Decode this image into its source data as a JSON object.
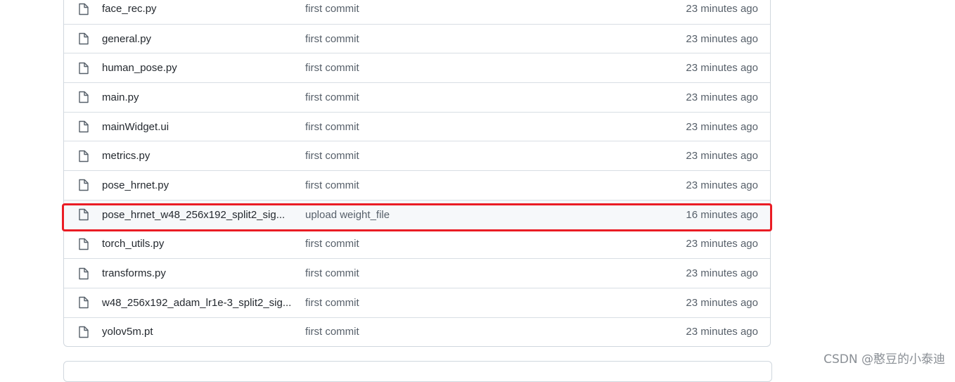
{
  "file_list": {
    "rows": [
      {
        "icon": "file-icon",
        "name": "face_rec.py",
        "message": "first commit",
        "age": "23 minutes ago"
      },
      {
        "icon": "file-icon",
        "name": "general.py",
        "message": "first commit",
        "age": "23 minutes ago"
      },
      {
        "icon": "file-icon",
        "name": "human_pose.py",
        "message": "first commit",
        "age": "23 minutes ago"
      },
      {
        "icon": "file-icon",
        "name": "main.py",
        "message": "first commit",
        "age": "23 minutes ago"
      },
      {
        "icon": "file-icon",
        "name": "mainWidget.ui",
        "message": "first commit",
        "age": "23 minutes ago"
      },
      {
        "icon": "file-icon",
        "name": "metrics.py",
        "message": "first commit",
        "age": "23 minutes ago"
      },
      {
        "icon": "file-icon",
        "name": "pose_hrnet.py",
        "message": "first commit",
        "age": "23 minutes ago"
      },
      {
        "icon": "file-icon",
        "name": "pose_hrnet_w48_256x192_split2_sig...",
        "message": "upload weight_file",
        "age": "16 minutes ago"
      },
      {
        "icon": "file-icon",
        "name": "torch_utils.py",
        "message": "first commit",
        "age": "23 minutes ago"
      },
      {
        "icon": "file-icon",
        "name": "transforms.py",
        "message": "first commit",
        "age": "23 minutes ago"
      },
      {
        "icon": "file-icon",
        "name": "w48_256x192_adam_lr1e-3_split2_sig...",
        "message": "first commit",
        "age": "23 minutes ago"
      },
      {
        "icon": "file-icon",
        "name": "yolov5m.pt",
        "message": "first commit",
        "age": "23 minutes ago"
      }
    ]
  },
  "annotation": {
    "highlight_color": "#ea1c24",
    "highlighted_row": "pose_hrnet_w48_256x192_split2_sig..."
  },
  "watermark": {
    "text": "CSDN @憨豆的小泰迪"
  }
}
